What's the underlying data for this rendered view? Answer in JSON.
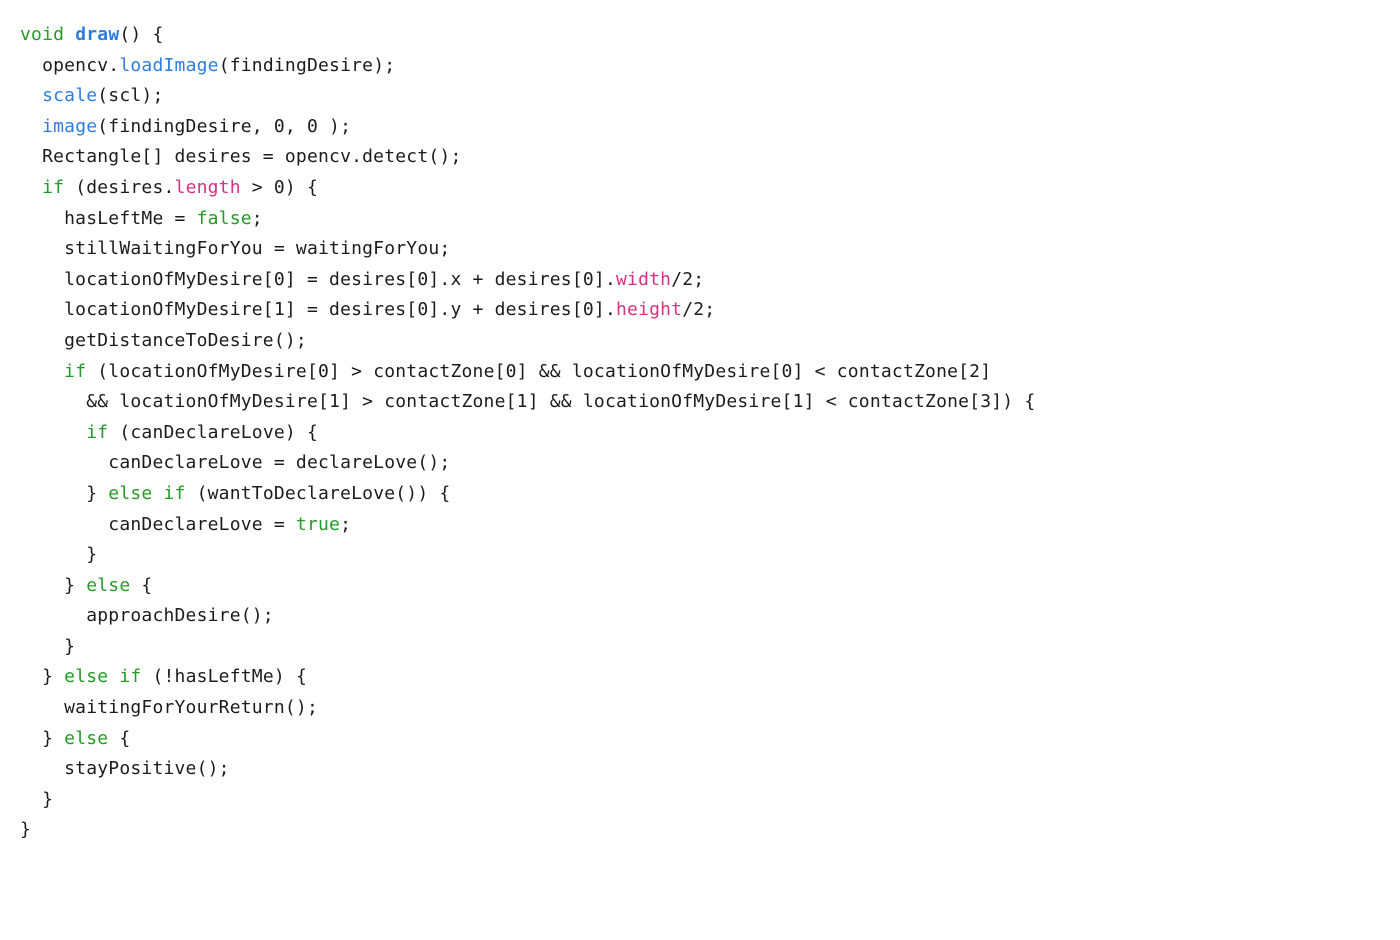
{
  "tokens": [
    [
      [
        "type",
        "void"
      ],
      [
        "n",
        " "
      ],
      [
        "boldfn",
        "draw"
      ],
      [
        "n",
        "() {"
      ]
    ],
    [
      [
        "n",
        "  opencv."
      ],
      [
        "fn",
        "loadImage"
      ],
      [
        "n",
        "(findingDesire);"
      ]
    ],
    [
      [
        "n",
        "  "
      ],
      [
        "fn",
        "scale"
      ],
      [
        "n",
        "(scl);"
      ]
    ],
    [
      [
        "n",
        "  "
      ],
      [
        "fn",
        "image"
      ],
      [
        "n",
        "(findingDesire, 0, 0 );"
      ]
    ],
    [
      [
        "n",
        "  Rectangle[] desires = opencv.detect();"
      ]
    ],
    [
      [
        "n",
        "  "
      ],
      [
        "kw",
        "if"
      ],
      [
        "n",
        " (desires."
      ],
      [
        "prop",
        "length"
      ],
      [
        "n",
        " > 0) {"
      ]
    ],
    [
      [
        "n",
        "    hasLeftMe = "
      ],
      [
        "const",
        "false"
      ],
      [
        "n",
        ";"
      ]
    ],
    [
      [
        "n",
        "    stillWaitingForYou = waitingForYou;"
      ]
    ],
    [
      [
        "n",
        "    locationOfMyDesire[0] = desires[0].x + desires[0]."
      ],
      [
        "prop",
        "width"
      ],
      [
        "n",
        "/2;"
      ]
    ],
    [
      [
        "n",
        "    locationOfMyDesire[1] = desires[0].y + desires[0]."
      ],
      [
        "prop",
        "height"
      ],
      [
        "n",
        "/2;"
      ]
    ],
    [
      [
        "n",
        "    getDistanceToDesire();"
      ]
    ],
    [
      [
        "n",
        "    "
      ],
      [
        "kw",
        "if"
      ],
      [
        "n",
        " (locationOfMyDesire[0] > contactZone[0] && locationOfMyDesire[0] < contactZone[2]"
      ]
    ],
    [
      [
        "n",
        "      && locationOfMyDesire[1] > contactZone[1] && locationOfMyDesire[1] < contactZone[3]) {"
      ]
    ],
    [
      [
        "n",
        "      "
      ],
      [
        "kw",
        "if"
      ],
      [
        "n",
        " (canDeclareLove) {"
      ]
    ],
    [
      [
        "n",
        "        canDeclareLove = declareLove();"
      ]
    ],
    [
      [
        "n",
        "      } "
      ],
      [
        "kw",
        "else if"
      ],
      [
        "n",
        " (wantToDeclareLove()) {"
      ]
    ],
    [
      [
        "n",
        "        canDeclareLove = "
      ],
      [
        "const",
        "true"
      ],
      [
        "n",
        ";"
      ]
    ],
    [
      [
        "n",
        "      }"
      ]
    ],
    [
      [
        "n",
        "    } "
      ],
      [
        "kw",
        "else"
      ],
      [
        "n",
        " {"
      ]
    ],
    [
      [
        "n",
        "      approachDesire();"
      ]
    ],
    [
      [
        "n",
        "    }"
      ]
    ],
    [
      [
        "n",
        "  } "
      ],
      [
        "kw",
        "else if"
      ],
      [
        "n",
        " (!hasLeftMe) {"
      ]
    ],
    [
      [
        "n",
        "    waitingForYourReturn();"
      ]
    ],
    [
      [
        "n",
        "  } "
      ],
      [
        "kw",
        "else"
      ],
      [
        "n",
        " {"
      ]
    ],
    [
      [
        "n",
        "    stayPositive();"
      ]
    ],
    [
      [
        "n",
        "  }"
      ]
    ],
    [
      [
        "n",
        "}"
      ]
    ]
  ]
}
